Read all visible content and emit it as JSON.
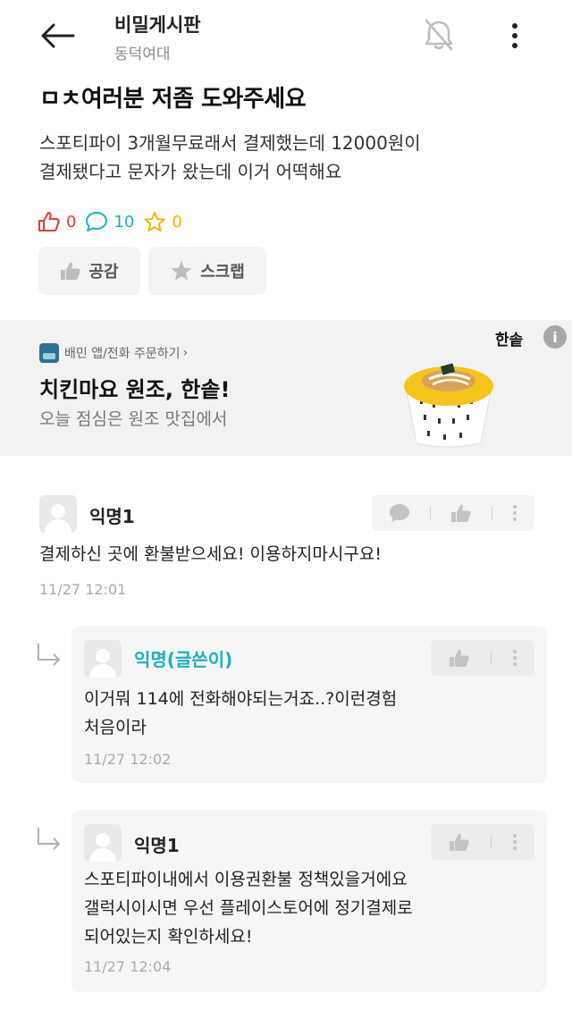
{
  "header": {
    "board_title": "비밀게시판",
    "board_subtitle": "동덕여대",
    "back_icon": "arrow-left-icon",
    "bell_icon": "bell-off-icon",
    "more_icon": "more-vertical-icon"
  },
  "post": {
    "title": "ㅁㅊ여러분 저좀 도와주세요",
    "body_line1": "스포티파이 3개월무료래서 결제했는데 12000원이",
    "body_line2": "결제됐다고 문자가 왔는데 이거 어떡해요",
    "like_count": "0",
    "comment_count": "10",
    "scrap_count": "0",
    "like_button": "공감",
    "scrap_button": "스크랩",
    "colors": {
      "like": "#e53935",
      "comment": "#1eb0b9",
      "scrap": "#f2b600"
    }
  },
  "ad": {
    "source": "배민 앱/전화 주문하기",
    "headline": "치킨마요 원조, 한솥!",
    "description": "오늘 점심은 원조 맛집에서",
    "brand": "한솥",
    "info_label": "i"
  },
  "comments": [
    {
      "author": "익명1",
      "text": "결제하신 곳에 환불받으세요! 이용하지마시구요!",
      "time": "11/27 12:01",
      "tools": [
        "reply-icon",
        "thumbs-up-icon",
        "more-vertical-icon"
      ]
    }
  ],
  "replies": [
    {
      "author": "익명(글쓴이)",
      "is_op": true,
      "text_line1": "이거뭐 114에 전화해야되는거죠..?이런경험",
      "text_line2": "처음이라",
      "time": "11/27 12:02"
    },
    {
      "author": "익명1",
      "is_op": false,
      "text_line1": "스포티파이내에서 이용권환불 정책있을거에요",
      "text_line2": "갤럭시이시면 우선 플레이스토어에 정기결제로",
      "text_line3": "되어있는지 확인하세요!",
      "time": "11/27 12:04"
    }
  ]
}
